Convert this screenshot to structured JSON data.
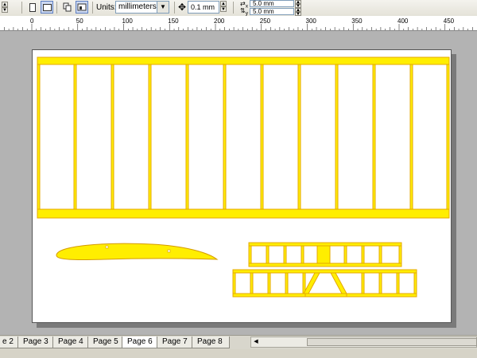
{
  "toolbar": {
    "units_label": "Units:",
    "units_value": "millimeters",
    "nudge_value": "0.1 mm",
    "dup_x": "5.0 mm",
    "dup_y": "5.0 mm",
    "dup_x_axis": "x",
    "dup_y_axis": "y"
  },
  "ruler": {
    "ticks": [
      "0",
      "50",
      "100",
      "150",
      "200",
      "250",
      "300",
      "350",
      "400",
      "450"
    ]
  },
  "tabs": [
    {
      "label": "e 2"
    },
    {
      "label": "Page 3"
    },
    {
      "label": "Page 4"
    },
    {
      "label": "Page 5"
    },
    {
      "label": "Page 6",
      "active": true
    },
    {
      "label": "Page 7"
    },
    {
      "label": "Page 8"
    }
  ],
  "colors": {
    "part_fill": "#ffee00",
    "part_stroke": "#e6a800"
  }
}
